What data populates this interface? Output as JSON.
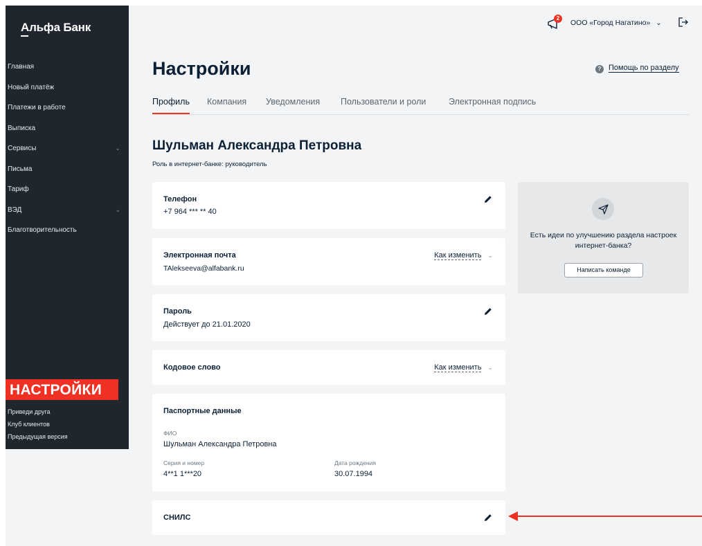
{
  "sidebar": {
    "logo": "Альфа Банк",
    "items": [
      {
        "label": "Главная"
      },
      {
        "label": "Новый платёж"
      },
      {
        "label": "Платежи в работе"
      },
      {
        "label": "Выписка"
      },
      {
        "label": "Сервисы",
        "expandable": true
      },
      {
        "label": "Письма"
      },
      {
        "label": "Тариф"
      },
      {
        "label": "ВЭД",
        "expandable": true
      },
      {
        "label": "Благотворительность"
      }
    ],
    "highlight_label": "НАСТРОЙКИ",
    "bottom_items": [
      {
        "label": "Приведи друга"
      },
      {
        "label": "Клуб клиентов"
      },
      {
        "label": "Предыдущая версия"
      }
    ]
  },
  "header": {
    "notifications_count": "2",
    "company": "ООО «Город Нагатино»"
  },
  "page": {
    "title": "Настройки",
    "help_link": "Помощь по разделу",
    "tabs": [
      {
        "label": "Профиль",
        "active": true
      },
      {
        "label": "Компания"
      },
      {
        "label": "Уведомления"
      },
      {
        "label": "Пользователи и роли"
      },
      {
        "label": "Электронная подпись"
      }
    ],
    "person_name": "Шульман Александра Петровна",
    "role": "Роль в интернет-банке: руководитель"
  },
  "cards": {
    "phone": {
      "title": "Телефон",
      "value": "+7 964 *** ** 40"
    },
    "email": {
      "title": "Электронная почта",
      "value": "TAlekseeva@alfabank.ru",
      "action": "Как изменить"
    },
    "password": {
      "title": "Пароль",
      "value": "Действует до 21.01.2020"
    },
    "codeword": {
      "title": "Кодовое слово",
      "action": "Как изменить"
    },
    "passport": {
      "title": "Паспортные данные",
      "fio_label": "ФИО",
      "fio_value": "Шульман Александра Петровна",
      "series_label": "Серия и номер",
      "series_value": "4**1 1***20",
      "birth_label": "Дата рождения",
      "birth_value": "30.07.1994"
    },
    "snils": {
      "title": "СНИЛС"
    }
  },
  "idea": {
    "text": "Есть идеи по улучшению раздела настроек интернет-банка?",
    "button": "Написать команде"
  },
  "colors": {
    "accent": "#ef3124",
    "sidebar_bg": "#1f262e",
    "page_bg": "#f3f4f5"
  }
}
